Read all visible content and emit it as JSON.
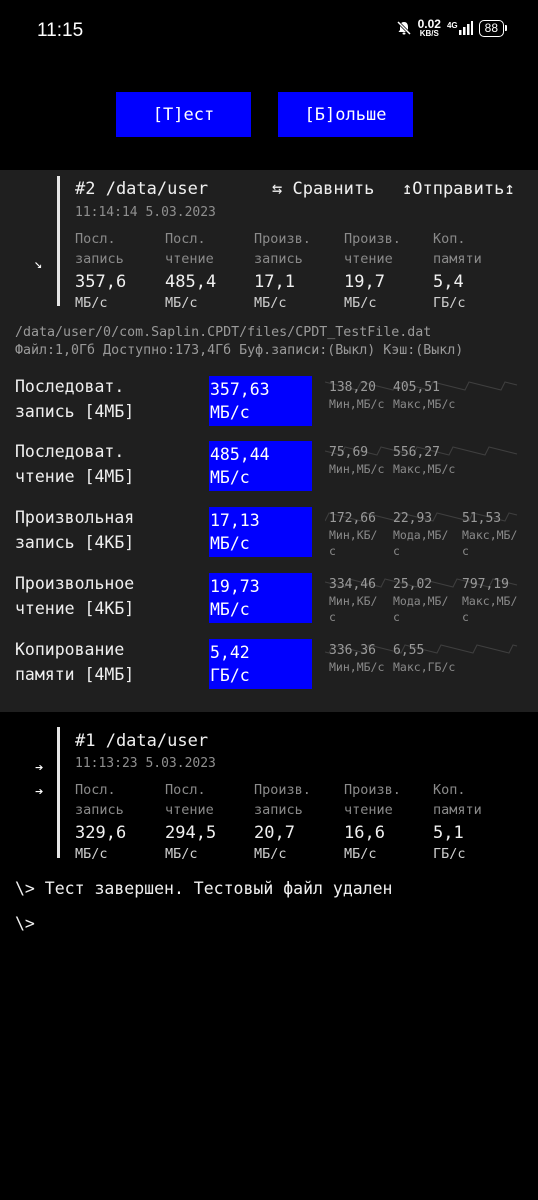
{
  "status_bar": {
    "time": "11:15",
    "net_speed": "0.02",
    "net_unit": "KB/S",
    "signal": "4G",
    "battery": "88"
  },
  "toolbar": {
    "test_label": "[T]ест",
    "more_label": "[Б]ольше"
  },
  "run2": {
    "title": "#2 /data/user",
    "datetime": "11:14:14 5.03.2023",
    "compare_label": "⇆ Сравнить",
    "send_label": "↥Отправить↥",
    "metrics": [
      {
        "l1": "Посл.",
        "l2": "запись",
        "value": "357,6",
        "unit": "МБ/с"
      },
      {
        "l1": "Посл.",
        "l2": "чтение",
        "value": "485,4",
        "unit": "МБ/с"
      },
      {
        "l1": "Произв.",
        "l2": "запись",
        "value": "17,1",
        "unit": "МБ/с"
      },
      {
        "l1": "Произв.",
        "l2": "чтение",
        "value": "19,7",
        "unit": "МБ/с"
      },
      {
        "l1": "Коп.",
        "l2": "памяти",
        "value": "5,4",
        "unit": "ГБ/с"
      }
    ],
    "file_path": "/data/user/0/com.Saplin.CPDT/files/CPDT_TestFile.dat",
    "file_info": "Файл:1,0Гб Доступно:173,4Гб Буф.записи:(Выкл) Кэш:(Выкл)",
    "tests": [
      {
        "l1": "Последоват.",
        "l2": "запись [4МБ]",
        "v1": "357,63",
        "v2": "МБ/с",
        "stats": [
          {
            "n": "138,20",
            "s1": "Мин,МБ/с",
            "s2": ""
          },
          {
            "n": "405,51",
            "s1": "Макс,МБ/с",
            "s2": ""
          }
        ]
      },
      {
        "l1": "Последоват.",
        "l2": "чтение [4МБ]",
        "v1": "485,44",
        "v2": "МБ/с",
        "stats": [
          {
            "n": "75,69",
            "s1": "Мин,МБ/с",
            "s2": ""
          },
          {
            "n": "556,27",
            "s1": "Макс,МБ/с",
            "s2": ""
          }
        ]
      },
      {
        "l1": "Произвольная",
        "l2": "запись [4КБ]",
        "v1": "17,13",
        "v2": "МБ/с",
        "stats": [
          {
            "n": "172,66",
            "s1": "Мин,КБ/",
            "s2": "с"
          },
          {
            "n": "22,93",
            "s1": "Мода,МБ/",
            "s2": "с"
          },
          {
            "n": "51,53",
            "s1": "Макс,МБ/",
            "s2": "с"
          }
        ]
      },
      {
        "l1": "Произвольное",
        "l2": "чтение [4КБ]",
        "v1": "19,73",
        "v2": "МБ/с",
        "stats": [
          {
            "n": "334,46",
            "s1": "Мин,КБ/",
            "s2": "с"
          },
          {
            "n": "25,02",
            "s1": "Мода,МБ/",
            "s2": "с"
          },
          {
            "n": "797,19",
            "s1": "Макс,МБ/",
            "s2": "с"
          }
        ]
      },
      {
        "l1": "Копирование",
        "l2": "памяти [4МБ]",
        "v1": "5,42",
        "v2": "ГБ/с",
        "stats": [
          {
            "n": "336,36",
            "s1": "Мин,МБ/с",
            "s2": ""
          },
          {
            "n": "6,55",
            "s1": "Макс,ГБ/с",
            "s2": ""
          }
        ]
      }
    ]
  },
  "run1": {
    "title": "#1 /data/user",
    "datetime": "11:13:23 5.03.2023",
    "metrics": [
      {
        "l1": "Посл.",
        "l2": "запись",
        "value": "329,6",
        "unit": "МБ/с"
      },
      {
        "l1": "Посл.",
        "l2": "чтение",
        "value": "294,5",
        "unit": "МБ/с"
      },
      {
        "l1": "Произв.",
        "l2": "запись",
        "value": "20,7",
        "unit": "МБ/с"
      },
      {
        "l1": "Произв.",
        "l2": "чтение",
        "value": "16,6",
        "unit": "МБ/с"
      },
      {
        "l1": "Коп.",
        "l2": "памяти",
        "value": "5,1",
        "unit": "ГБ/с"
      }
    ]
  },
  "console": {
    "line1": "\\> Тест завершен. Тестовый файл удален",
    "prompt": "\\>"
  }
}
